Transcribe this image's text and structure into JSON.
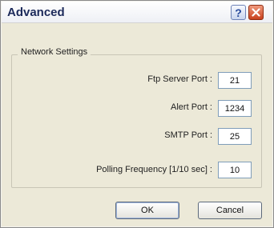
{
  "window": {
    "title": "Advanced",
    "help_glyph": "?",
    "icons": {
      "help": "help-icon",
      "close": "close-icon"
    }
  },
  "group": {
    "title": "Network Settings"
  },
  "fields": [
    {
      "label": "Ftp Server Port :",
      "value": "21"
    },
    {
      "label": "Alert Port :",
      "value": "1234"
    },
    {
      "label": "SMTP Port :",
      "value": "25"
    },
    {
      "label": "Polling Frequency [1/10 sec] :",
      "value": "10"
    }
  ],
  "buttons": {
    "ok": "OK",
    "cancel": "Cancel"
  },
  "colors": {
    "dialog_background": "#ece9d8",
    "close_button": "#c8411e",
    "input_border": "#7f9db9"
  }
}
